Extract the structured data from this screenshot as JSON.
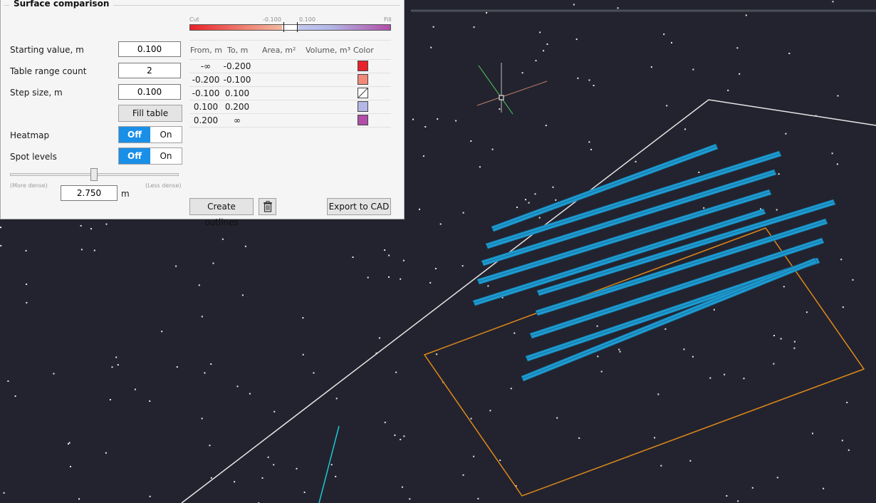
{
  "panel": {
    "title": "Surface comparison",
    "starting_value_label": "Starting value, m",
    "starting_value": "0.100",
    "table_range_count_label": "Table range count",
    "table_range_count": "2",
    "step_size_label": "Step size, m",
    "step_size": "0.100",
    "fill_table_label": "Fill table",
    "heatmap_label": "Heatmap",
    "spot_levels_label": "Spot levels",
    "toggle_off": "Off",
    "toggle_on": "On",
    "density_more": "(More dense)",
    "density_less": "(Less dense)",
    "density_value": "2.750",
    "density_unit": "m",
    "density_level": 0.52,
    "create_outlines_label": "Create outlines",
    "export_label": "Export to CAD"
  },
  "gradient": {
    "cut_label": "Cut",
    "fill_label": "Fill",
    "neg_label": "-0.100",
    "pos_label": "0.100"
  },
  "table": {
    "headers": {
      "from": "From, m",
      "to": "To, m",
      "area": "Area, m²",
      "volume": "Volume, m³",
      "color": "Color"
    },
    "rows": [
      {
        "from": "-∞",
        "to": "-0.200",
        "color": "#e8222a"
      },
      {
        "from": "-0.200",
        "to": "-0.100",
        "color": "#f08a78"
      },
      {
        "from": "-0.100",
        "to": "0.100",
        "color": "none"
      },
      {
        "from": "0.100",
        "to": "0.200",
        "color": "#b3b7e6"
      },
      {
        "from": "0.200",
        "to": "∞",
        "color": "#b04ea8"
      }
    ]
  },
  "colors": {
    "accent": "#1a8fe8",
    "viewport_bg": "#23232f",
    "panels_3d": "#1e9ad0",
    "boundary_orange": "#e08a18"
  }
}
